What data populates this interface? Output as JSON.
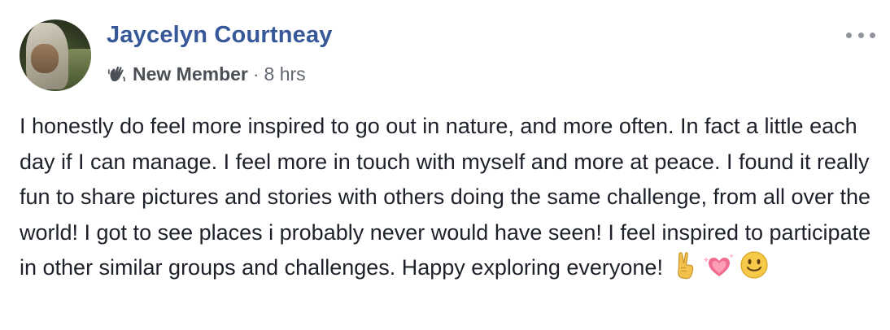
{
  "post": {
    "author_name": "Jaycelyn Courtneay",
    "badge": "New Member",
    "separator": "·",
    "timestamp": "8 hrs",
    "text": "I honestly do feel more inspired to go out in nature, and more often. In fact a little each day if I can manage. I feel more in touch with myself and more at peace. I found it really fun to share pictures and stories with others doing the same challenge, from all over the world! I got to see places i probably never would have seen! I feel inspired to participate in other similar groups and challenges. Happy exploring everyone!",
    "emojis": [
      "victory-hand-icon",
      "sparkling-heart-icon",
      "smiling-face-icon"
    ]
  },
  "icons": {
    "badge_icon": "waving-hand-icon",
    "menu_icon": "more-options-icon"
  },
  "colors": {
    "author_name": "#365899",
    "body_text": "#1d2129",
    "meta_text": "#616770",
    "menu_dots": "#90949c",
    "background": "#ffffff"
  }
}
